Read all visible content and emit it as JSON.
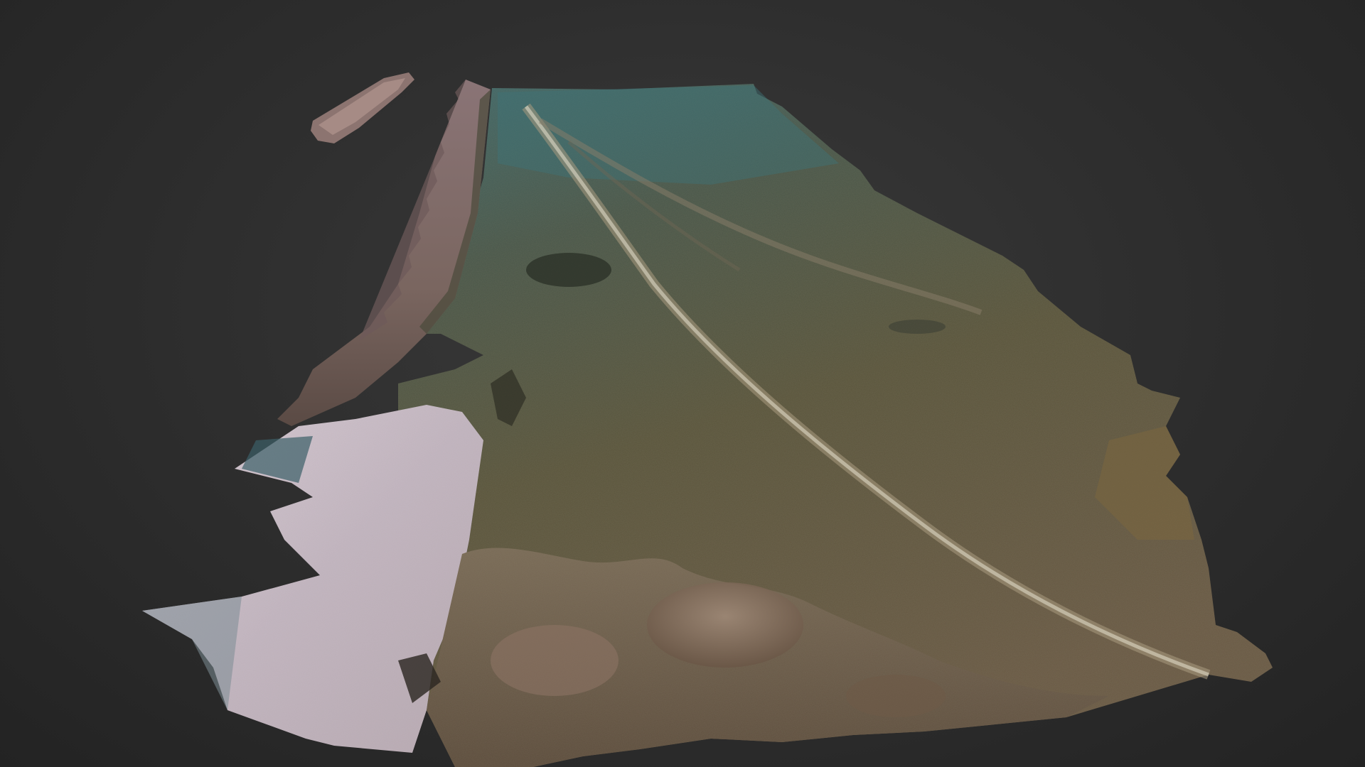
{
  "viewer": {
    "background_color": "#2d2d2d",
    "model_name": "",
    "colors": {
      "water_teal": "#3f6b70",
      "seabed_olive": "#5b5a3a",
      "rock_brown": "#7a6a55",
      "sand_white": "#c9bcc6",
      "wall_pink": "#9a7f82",
      "shadow": "#1e1e1e"
    }
  }
}
